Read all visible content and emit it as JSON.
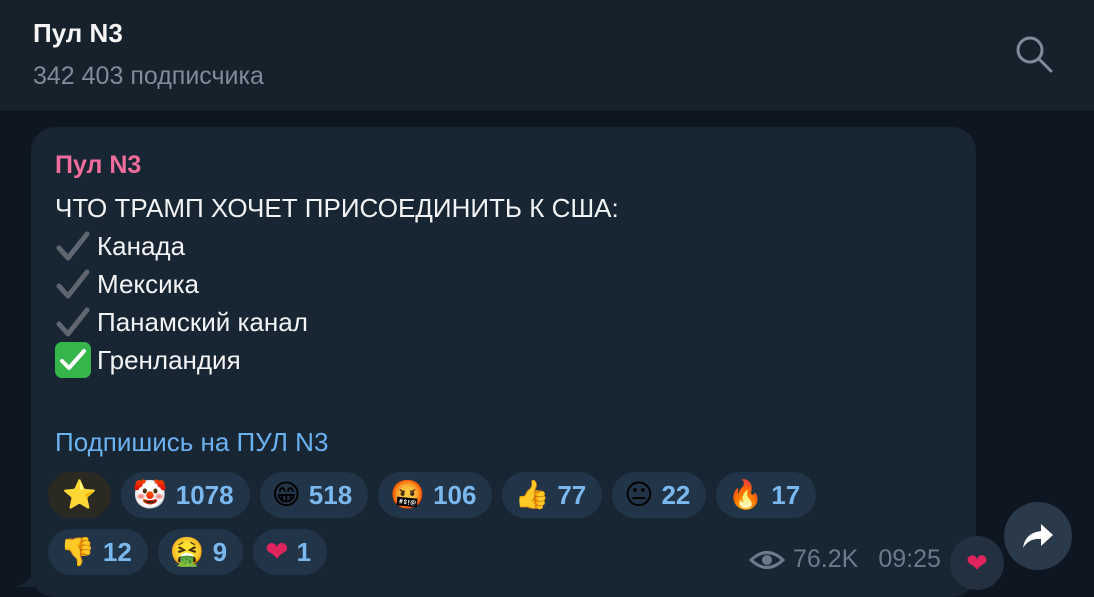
{
  "header": {
    "title": "Пул N3",
    "subscribers": "342 403 подписчика"
  },
  "message": {
    "author": "Пул N3",
    "heading": "ЧТО ТРАМП ХОЧЕТ ПРИСОЕДИНИТЬ К США:",
    "items": [
      {
        "label": "Канада",
        "icon": "grey-checkmark-icon"
      },
      {
        "label": "Мексика",
        "icon": "grey-checkmark-icon"
      },
      {
        "label": "Панамский канал",
        "icon": "grey-checkmark-icon"
      },
      {
        "label": "Гренландия",
        "icon": "green-check-box-icon"
      }
    ],
    "link": "Подпишись на ПУЛ N3",
    "views": "76.2K",
    "time": "09:25"
  },
  "reactions": [
    {
      "emoji": "⭐",
      "count": "",
      "icon": "star-icon"
    },
    {
      "emoji": "🤡",
      "count": "1078",
      "icon": "clown-icon"
    },
    {
      "emoji": "😁",
      "count": "518",
      "icon": "grin-icon"
    },
    {
      "emoji": "🤬",
      "count": "106",
      "icon": "cursing-face-icon"
    },
    {
      "emoji": "👍",
      "count": "77",
      "icon": "thumbs-up-icon"
    },
    {
      "emoji": "😐",
      "count": "22",
      "icon": "neutral-face-icon"
    },
    {
      "emoji": "🔥",
      "count": "17",
      "icon": "fire-icon"
    },
    {
      "emoji": "👎",
      "count": "12",
      "icon": "thumbs-down-icon"
    },
    {
      "emoji": "🤮",
      "count": "9",
      "icon": "vomit-face-icon"
    },
    {
      "emoji": "❤",
      "count": "1",
      "icon": "heart-icon"
    }
  ],
  "colors": {
    "background": "#0e1621",
    "header": "#17212b",
    "bubble": "#182533",
    "author": "#ee6d9c",
    "link": "#6ab2f2",
    "reaction_count": "#7ab8ee"
  }
}
